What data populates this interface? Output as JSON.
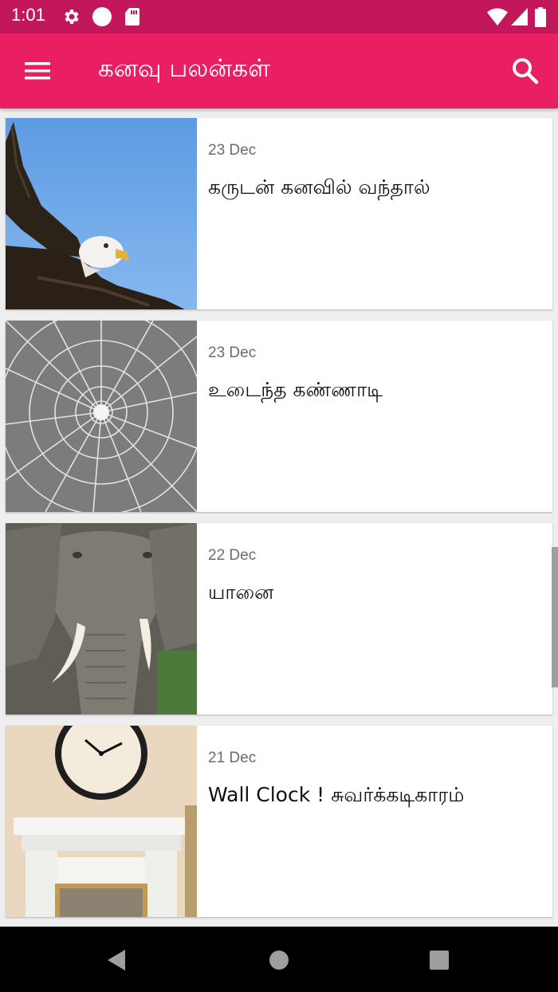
{
  "status_bar": {
    "time": "1:01",
    "icons": [
      "gear-icon",
      "circle-icon",
      "sd-card-icon",
      "wifi-icon",
      "cell-signal-icon",
      "battery-icon"
    ]
  },
  "app_bar": {
    "title": "கனவு பலன்கள்",
    "menu_icon": "hamburger-menu-icon",
    "search_icon": "search-icon",
    "background": "#e91e63",
    "status_bar_background": "#c2185b"
  },
  "items": [
    {
      "date": "23 Dec",
      "title": "கருடன் கனவில் வந்தால்",
      "thumbnail": "eagle-image"
    },
    {
      "date": "23 Dec",
      "title": "உடைந்த கண்ணாடி",
      "thumbnail": "broken-glass-image"
    },
    {
      "date": "22 Dec",
      "title": "யானை",
      "thumbnail": "elephant-image"
    },
    {
      "date": "21 Dec",
      "title": "Wall Clock ! சுவர்க்கடிகாரம்",
      "thumbnail": "wall-clock-image"
    }
  ],
  "nav_bar": {
    "back_icon": "back-triangle-icon",
    "home_icon": "home-circle-icon",
    "recents_icon": "recents-square-icon"
  }
}
